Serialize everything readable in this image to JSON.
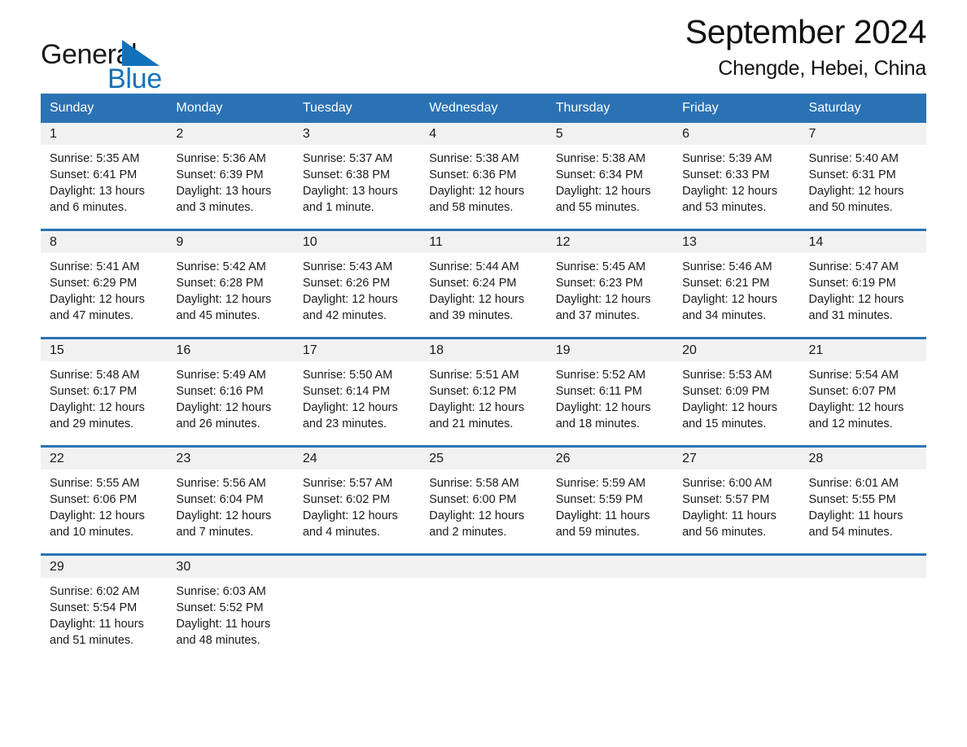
{
  "brand": {
    "name_part1": "General",
    "name_part2": "Blue",
    "triangle_icon": "triangle-icon",
    "accent_color": "#1271bd"
  },
  "header": {
    "title": "September 2024",
    "subtitle": "Chengde, Hebei, China"
  },
  "theme": {
    "header_blue": "#2b72b4",
    "daynum_band": "#f1f1f1",
    "text": "#1a1a1a"
  },
  "calendar": {
    "weekday_headers": [
      "Sunday",
      "Monday",
      "Tuesday",
      "Wednesday",
      "Thursday",
      "Friday",
      "Saturday"
    ],
    "weeks": [
      [
        {
          "day": "1",
          "sunrise": "Sunrise: 5:35 AM",
          "sunset": "Sunset: 6:41 PM",
          "daylight": "Daylight: 13 hours and 6 minutes."
        },
        {
          "day": "2",
          "sunrise": "Sunrise: 5:36 AM",
          "sunset": "Sunset: 6:39 PM",
          "daylight": "Daylight: 13 hours and 3 minutes."
        },
        {
          "day": "3",
          "sunrise": "Sunrise: 5:37 AM",
          "sunset": "Sunset: 6:38 PM",
          "daylight": "Daylight: 13 hours and 1 minute."
        },
        {
          "day": "4",
          "sunrise": "Sunrise: 5:38 AM",
          "sunset": "Sunset: 6:36 PM",
          "daylight": "Daylight: 12 hours and 58 minutes."
        },
        {
          "day": "5",
          "sunrise": "Sunrise: 5:38 AM",
          "sunset": "Sunset: 6:34 PM",
          "daylight": "Daylight: 12 hours and 55 minutes."
        },
        {
          "day": "6",
          "sunrise": "Sunrise: 5:39 AM",
          "sunset": "Sunset: 6:33 PM",
          "daylight": "Daylight: 12 hours and 53 minutes."
        },
        {
          "day": "7",
          "sunrise": "Sunrise: 5:40 AM",
          "sunset": "Sunset: 6:31 PM",
          "daylight": "Daylight: 12 hours and 50 minutes."
        }
      ],
      [
        {
          "day": "8",
          "sunrise": "Sunrise: 5:41 AM",
          "sunset": "Sunset: 6:29 PM",
          "daylight": "Daylight: 12 hours and 47 minutes."
        },
        {
          "day": "9",
          "sunrise": "Sunrise: 5:42 AM",
          "sunset": "Sunset: 6:28 PM",
          "daylight": "Daylight: 12 hours and 45 minutes."
        },
        {
          "day": "10",
          "sunrise": "Sunrise: 5:43 AM",
          "sunset": "Sunset: 6:26 PM",
          "daylight": "Daylight: 12 hours and 42 minutes."
        },
        {
          "day": "11",
          "sunrise": "Sunrise: 5:44 AM",
          "sunset": "Sunset: 6:24 PM",
          "daylight": "Daylight: 12 hours and 39 minutes."
        },
        {
          "day": "12",
          "sunrise": "Sunrise: 5:45 AM",
          "sunset": "Sunset: 6:23 PM",
          "daylight": "Daylight: 12 hours and 37 minutes."
        },
        {
          "day": "13",
          "sunrise": "Sunrise: 5:46 AM",
          "sunset": "Sunset: 6:21 PM",
          "daylight": "Daylight: 12 hours and 34 minutes."
        },
        {
          "day": "14",
          "sunrise": "Sunrise: 5:47 AM",
          "sunset": "Sunset: 6:19 PM",
          "daylight": "Daylight: 12 hours and 31 minutes."
        }
      ],
      [
        {
          "day": "15",
          "sunrise": "Sunrise: 5:48 AM",
          "sunset": "Sunset: 6:17 PM",
          "daylight": "Daylight: 12 hours and 29 minutes."
        },
        {
          "day": "16",
          "sunrise": "Sunrise: 5:49 AM",
          "sunset": "Sunset: 6:16 PM",
          "daylight": "Daylight: 12 hours and 26 minutes."
        },
        {
          "day": "17",
          "sunrise": "Sunrise: 5:50 AM",
          "sunset": "Sunset: 6:14 PM",
          "daylight": "Daylight: 12 hours and 23 minutes."
        },
        {
          "day": "18",
          "sunrise": "Sunrise: 5:51 AM",
          "sunset": "Sunset: 6:12 PM",
          "daylight": "Daylight: 12 hours and 21 minutes."
        },
        {
          "day": "19",
          "sunrise": "Sunrise: 5:52 AM",
          "sunset": "Sunset: 6:11 PM",
          "daylight": "Daylight: 12 hours and 18 minutes."
        },
        {
          "day": "20",
          "sunrise": "Sunrise: 5:53 AM",
          "sunset": "Sunset: 6:09 PM",
          "daylight": "Daylight: 12 hours and 15 minutes."
        },
        {
          "day": "21",
          "sunrise": "Sunrise: 5:54 AM",
          "sunset": "Sunset: 6:07 PM",
          "daylight": "Daylight: 12 hours and 12 minutes."
        }
      ],
      [
        {
          "day": "22",
          "sunrise": "Sunrise: 5:55 AM",
          "sunset": "Sunset: 6:06 PM",
          "daylight": "Daylight: 12 hours and 10 minutes."
        },
        {
          "day": "23",
          "sunrise": "Sunrise: 5:56 AM",
          "sunset": "Sunset: 6:04 PM",
          "daylight": "Daylight: 12 hours and 7 minutes."
        },
        {
          "day": "24",
          "sunrise": "Sunrise: 5:57 AM",
          "sunset": "Sunset: 6:02 PM",
          "daylight": "Daylight: 12 hours and 4 minutes."
        },
        {
          "day": "25",
          "sunrise": "Sunrise: 5:58 AM",
          "sunset": "Sunset: 6:00 PM",
          "daylight": "Daylight: 12 hours and 2 minutes."
        },
        {
          "day": "26",
          "sunrise": "Sunrise: 5:59 AM",
          "sunset": "Sunset: 5:59 PM",
          "daylight": "Daylight: 11 hours and 59 minutes."
        },
        {
          "day": "27",
          "sunrise": "Sunrise: 6:00 AM",
          "sunset": "Sunset: 5:57 PM",
          "daylight": "Daylight: 11 hours and 56 minutes."
        },
        {
          "day": "28",
          "sunrise": "Sunrise: 6:01 AM",
          "sunset": "Sunset: 5:55 PM",
          "daylight": "Daylight: 11 hours and 54 minutes."
        }
      ],
      [
        {
          "day": "29",
          "sunrise": "Sunrise: 6:02 AM",
          "sunset": "Sunset: 5:54 PM",
          "daylight": "Daylight: 11 hours and 51 minutes."
        },
        {
          "day": "30",
          "sunrise": "Sunrise: 6:03 AM",
          "sunset": "Sunset: 5:52 PM",
          "daylight": "Daylight: 11 hours and 48 minutes."
        },
        {
          "day": "",
          "sunrise": "",
          "sunset": "",
          "daylight": ""
        },
        {
          "day": "",
          "sunrise": "",
          "sunset": "",
          "daylight": ""
        },
        {
          "day": "",
          "sunrise": "",
          "sunset": "",
          "daylight": ""
        },
        {
          "day": "",
          "sunrise": "",
          "sunset": "",
          "daylight": ""
        },
        {
          "day": "",
          "sunrise": "",
          "sunset": "",
          "daylight": ""
        }
      ]
    ]
  }
}
